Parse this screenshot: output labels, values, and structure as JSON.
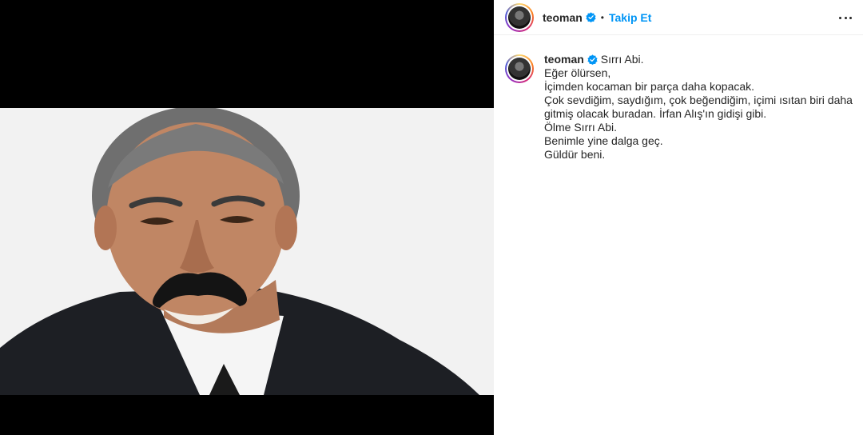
{
  "post": {
    "username": "teoman",
    "separator": "•",
    "follow_label": "Takip Et",
    "verified_icon": "verified-badge-icon",
    "more_icon": "more-options-icon",
    "accent_color": "#0095f6"
  },
  "caption": {
    "username": "teoman",
    "lines": [
      "Sırrı Abi.",
      "Eğer ölürsen,",
      "İçimden kocaman bir parça daha kopacak.",
      "Çok sevdiğim, saydığım, çok beğendiğim, içimi ısıtan biri daha",
      "gitmiş olacak buradan. İrfan Alış'ın gidişi gibi.",
      "Ölme Sırrı Abi.",
      "Benimle yine dalga geç.",
      "Güldür beni."
    ]
  }
}
